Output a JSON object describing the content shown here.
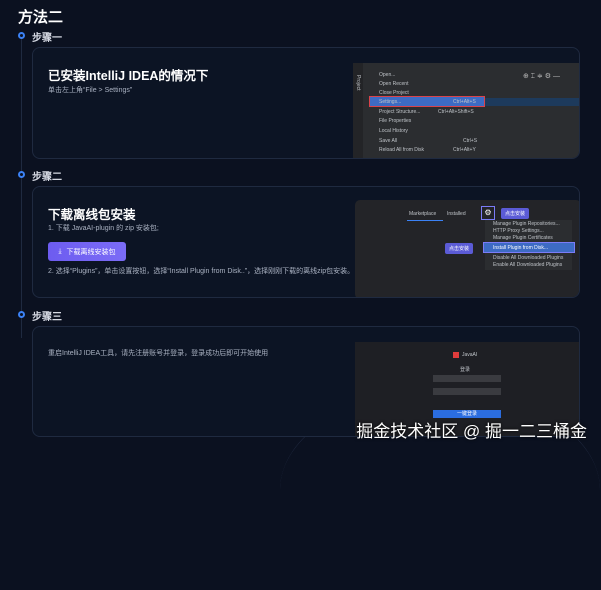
{
  "title": "方法二",
  "steps": [
    {
      "label": "步骤一",
      "heading": "已安装IntelliJ IDEA的情况下",
      "desc": "单击左上角“File > Settings”",
      "menu": [
        "Open...",
        "Open Recent",
        "Close Project",
        "Settings...",
        "Project Structure...",
        "File Properties",
        "Local History",
        "Save All",
        "Reload All from Disk"
      ],
      "shortcuts": {
        "settings": "Ctrl+Alt+S",
        "structure": "Ctrl+Alt+Shift+S",
        "save": "Ctrl+S",
        "reload": "Ctrl+Alt+Y"
      },
      "side_label": "Project"
    },
    {
      "label": "步骤二",
      "heading": "下载离线包安装",
      "desc1": "1. 下载 JavaAI-plugin 的 zip 安装包;",
      "button": "下载离线安装包",
      "desc2": "2. 选择“Plugins”，单击设置按钮，选择“Install Plugin from Disk..”，选择刚刚下载的离线zip包安装。",
      "tabs": [
        "Marketplace",
        "Installed"
      ],
      "menu": [
        "Manage Plugin Repositories...",
        "HTTP Proxy Settings...",
        "Manage Plugin Certificates",
        "Install Plugin from Disk...",
        "Disable All Downloaded Plugins",
        "Enable All Downloaded Plugins"
      ],
      "callout": "点击安装"
    },
    {
      "label": "步骤三",
      "desc": "重启IntelliJ IDEA工具，请先注册账号并登录，登录成功后即可开始使用",
      "login": {
        "brand": "JavaAI",
        "heading": "登录",
        "button": "一键登录"
      }
    }
  ],
  "watermark": "掘金技术社区 @ 掘一二三桶金"
}
